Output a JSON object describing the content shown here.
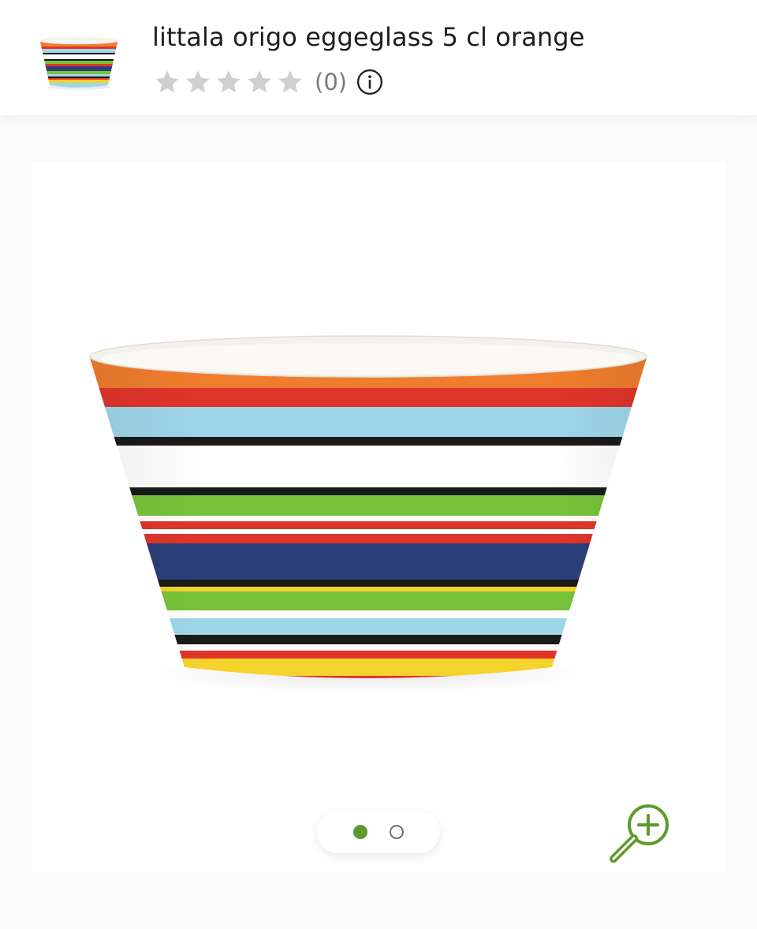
{
  "product": {
    "title": "littala origo eggeglass 5 cl orange",
    "rating_count": "(0)",
    "rating_value": 0,
    "rating_max": 5
  },
  "icons": {
    "star": "star-icon",
    "info": "info-icon",
    "zoom": "zoom-in-icon"
  },
  "gallery": {
    "image_count": 2,
    "active_index": 0
  },
  "colors": {
    "accent": "#5e9b2c",
    "star_inactive": "#cfcfcf",
    "title_text": "#1e1e1e",
    "count_text": "#7a7a7a",
    "stripes": [
      "#f07d2c",
      "#e0352b",
      "#9fd6ea",
      "#1a1a1a",
      "#78c33a",
      "#2c3f7a",
      "#f3d32c"
    ]
  }
}
